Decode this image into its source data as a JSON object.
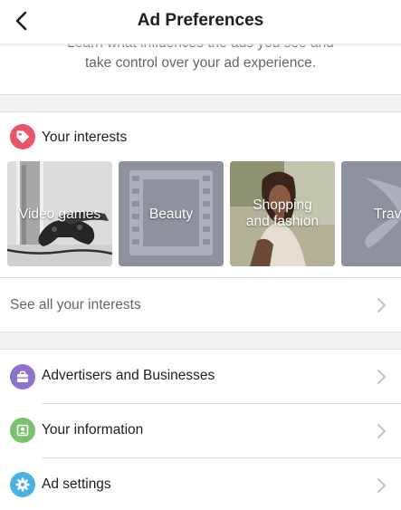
{
  "header": {
    "title": "Ad Preferences",
    "back_icon": "chevron-left-icon"
  },
  "intro": {
    "line1": "Learn what influences the ads you see and",
    "line2": "take control over your ad experience."
  },
  "interests": {
    "heading": "Your interests",
    "heading_icon": "tag-icon",
    "heading_icon_color": "#e9546b",
    "cards": [
      {
        "label": "Video games"
      },
      {
        "label": "Beauty"
      },
      {
        "label": "Shopping and fashion",
        "line1": "Shopping",
        "line2": "and fashion"
      },
      {
        "label": "Travel",
        "visible": "Trav"
      }
    ],
    "see_all": "See all your interests"
  },
  "menu": [
    {
      "label": "Advertisers and Businesses",
      "icon": "briefcase-icon",
      "color": "#8c72cb"
    },
    {
      "label": "Your information",
      "icon": "id-card-icon",
      "color": "#7bc270"
    },
    {
      "label": "Ad settings",
      "icon": "gear-icon",
      "color": "#4cb1e1"
    }
  ],
  "colors": {
    "text": "#1c1e21",
    "secondary": "#606770",
    "divider": "#dadde1",
    "section_bg": "#f2f3f5",
    "chevron": "#bec2c9"
  }
}
